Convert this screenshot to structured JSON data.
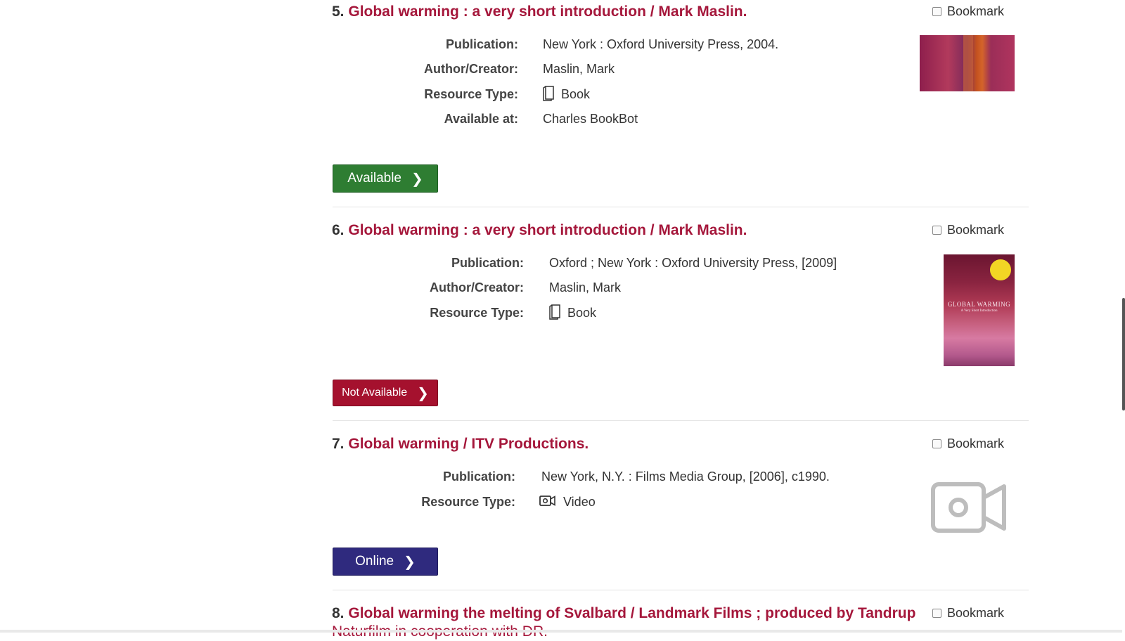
{
  "results": [
    {
      "number": "5.",
      "title": "Global warming : a very short introduction / Mark Maslin.",
      "bookmark_label": "Bookmark",
      "fields": [
        {
          "label": "Publication:",
          "value": "New York : Oxford University Press, 2004."
        },
        {
          "label": "Author/Creator:",
          "value": "Maslin, Mark"
        },
        {
          "label": "Resource Type:",
          "value": "Book",
          "icon": "book-icon"
        },
        {
          "label": "Available at:",
          "value": "Charles BookBot"
        }
      ],
      "button_label": "Available",
      "button_color": "#2e7d32",
      "thumbnail": "book-cover"
    },
    {
      "number": "6.",
      "title": "Global warming : a very short introduction / Mark Maslin.",
      "bookmark_label": "Bookmark",
      "fields": [
        {
          "label": "Publication:",
          "value": "Oxford ; New York : Oxford University Press, [2009]"
        },
        {
          "label": "Author/Creator:",
          "value": "Maslin, Mark"
        },
        {
          "label": "Resource Type:",
          "value": "Book",
          "icon": "book-icon"
        }
      ],
      "button_label": "Not Available",
      "button_color": "#a5112e",
      "thumbnail": "book-cover",
      "cover_title": "GLOBAL WARMING",
      "cover_subtitle": "A Very Short Introduction"
    },
    {
      "number": "7.",
      "title": "Global warming / ITV Productions.",
      "bookmark_label": "Bookmark",
      "fields": [
        {
          "label": "Publication:",
          "value": "New York, N.Y. : Films Media Group, [2006], c1990."
        },
        {
          "label": "Resource Type:",
          "value": "Video",
          "icon": "video-icon"
        }
      ],
      "button_label": "Online",
      "button_color": "#2f2a7e",
      "thumbnail": "video-placeholder-icon"
    },
    {
      "number": "8.",
      "title": "Global warming the melting of Svalbard / Landmark Films ; produced by Tandrup",
      "title_line2": "Naturfilm in cooperation with DR.",
      "bookmark_label": "Bookmark"
    }
  ],
  "colors": {
    "title_link": "#a5173b",
    "label_text": "#444444"
  }
}
